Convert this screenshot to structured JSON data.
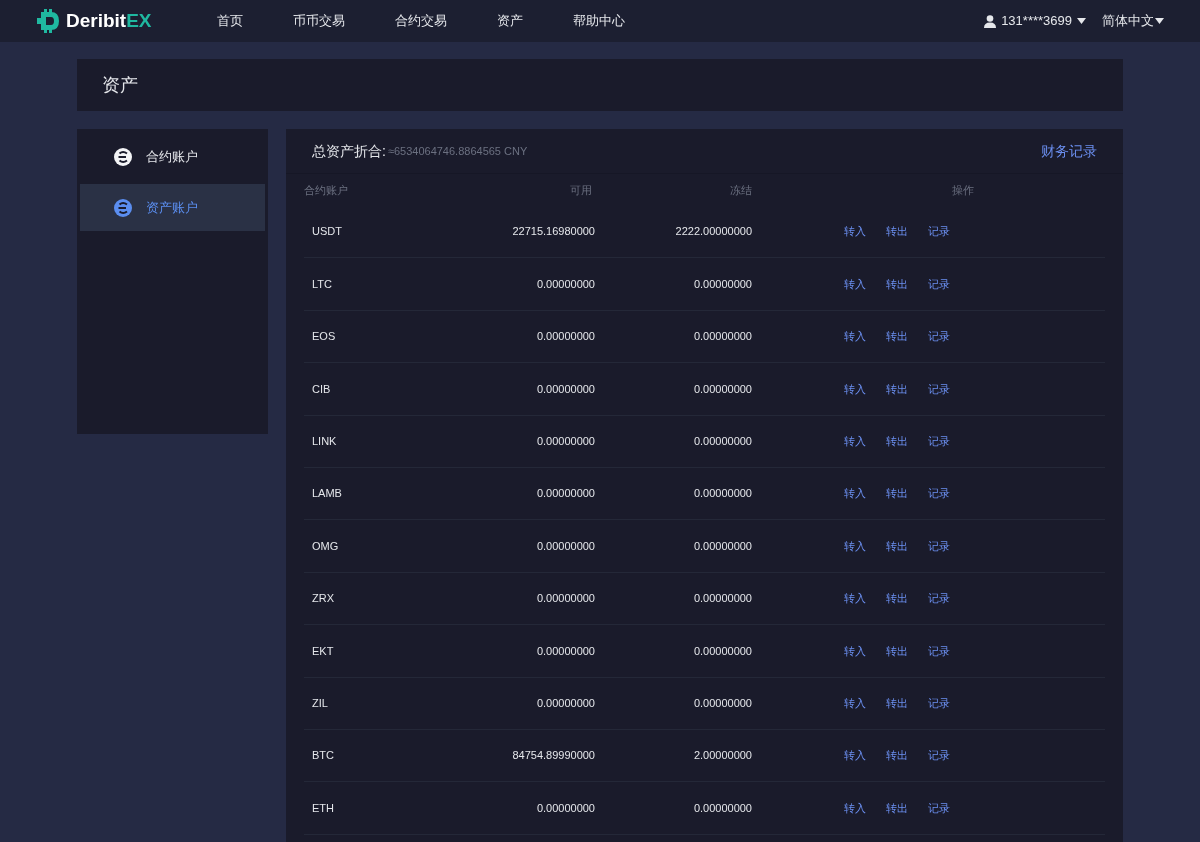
{
  "header": {
    "logo": {
      "text": "Deribit",
      "accent": "EX"
    },
    "nav": [
      {
        "label": "首页"
      },
      {
        "label": "币币交易"
      },
      {
        "label": "合约交易"
      },
      {
        "label": "资产"
      },
      {
        "label": "帮助中心"
      }
    ],
    "user": "131****3699",
    "language": "简体中文"
  },
  "page_title": "资产",
  "sidebar": {
    "items": [
      {
        "label": "合约账户",
        "selected": false
      },
      {
        "label": "资产账户",
        "selected": true
      }
    ]
  },
  "summary": {
    "label": "总资产折合:",
    "value": "≈6534064746.8864565 CNY",
    "link": "财务记录"
  },
  "table": {
    "columns": [
      "合约账户",
      "可用",
      "冻结",
      "操作"
    ],
    "rows": [
      {
        "coin": "USDT",
        "available": "22715.16980000",
        "frozen": "2222.00000000",
        "actions": [
          "转入",
          "转出",
          "记录"
        ]
      },
      {
        "coin": "LTC",
        "available": "0.00000000",
        "frozen": "0.00000000",
        "actions": [
          "转入",
          "转出",
          "记录"
        ]
      },
      {
        "coin": "EOS",
        "available": "0.00000000",
        "frozen": "0.00000000",
        "actions": [
          "转入",
          "转出",
          "记录"
        ]
      },
      {
        "coin": "CIB",
        "available": "0.00000000",
        "frozen": "0.00000000",
        "actions": [
          "转入",
          "转出",
          "记录"
        ]
      },
      {
        "coin": "LINK",
        "available": "0.00000000",
        "frozen": "0.00000000",
        "actions": [
          "转入",
          "转出",
          "记录"
        ]
      },
      {
        "coin": "LAMB",
        "available": "0.00000000",
        "frozen": "0.00000000",
        "actions": [
          "转入",
          "转出",
          "记录"
        ]
      },
      {
        "coin": "OMG",
        "available": "0.00000000",
        "frozen": "0.00000000",
        "actions": [
          "转入",
          "转出",
          "记录"
        ]
      },
      {
        "coin": "ZRX",
        "available": "0.00000000",
        "frozen": "0.00000000",
        "actions": [
          "转入",
          "转出",
          "记录"
        ]
      },
      {
        "coin": "EKT",
        "available": "0.00000000",
        "frozen": "0.00000000",
        "actions": [
          "转入",
          "转出",
          "记录"
        ]
      },
      {
        "coin": "ZIL",
        "available": "0.00000000",
        "frozen": "0.00000000",
        "actions": [
          "转入",
          "转出",
          "记录"
        ]
      },
      {
        "coin": "BTC",
        "available": "84754.89990000",
        "frozen": "2.00000000",
        "actions": [
          "转入",
          "转出",
          "记录"
        ]
      },
      {
        "coin": "ETH",
        "available": "0.00000000",
        "frozen": "0.00000000",
        "actions": [
          "转入",
          "转出",
          "记录"
        ]
      }
    ]
  }
}
